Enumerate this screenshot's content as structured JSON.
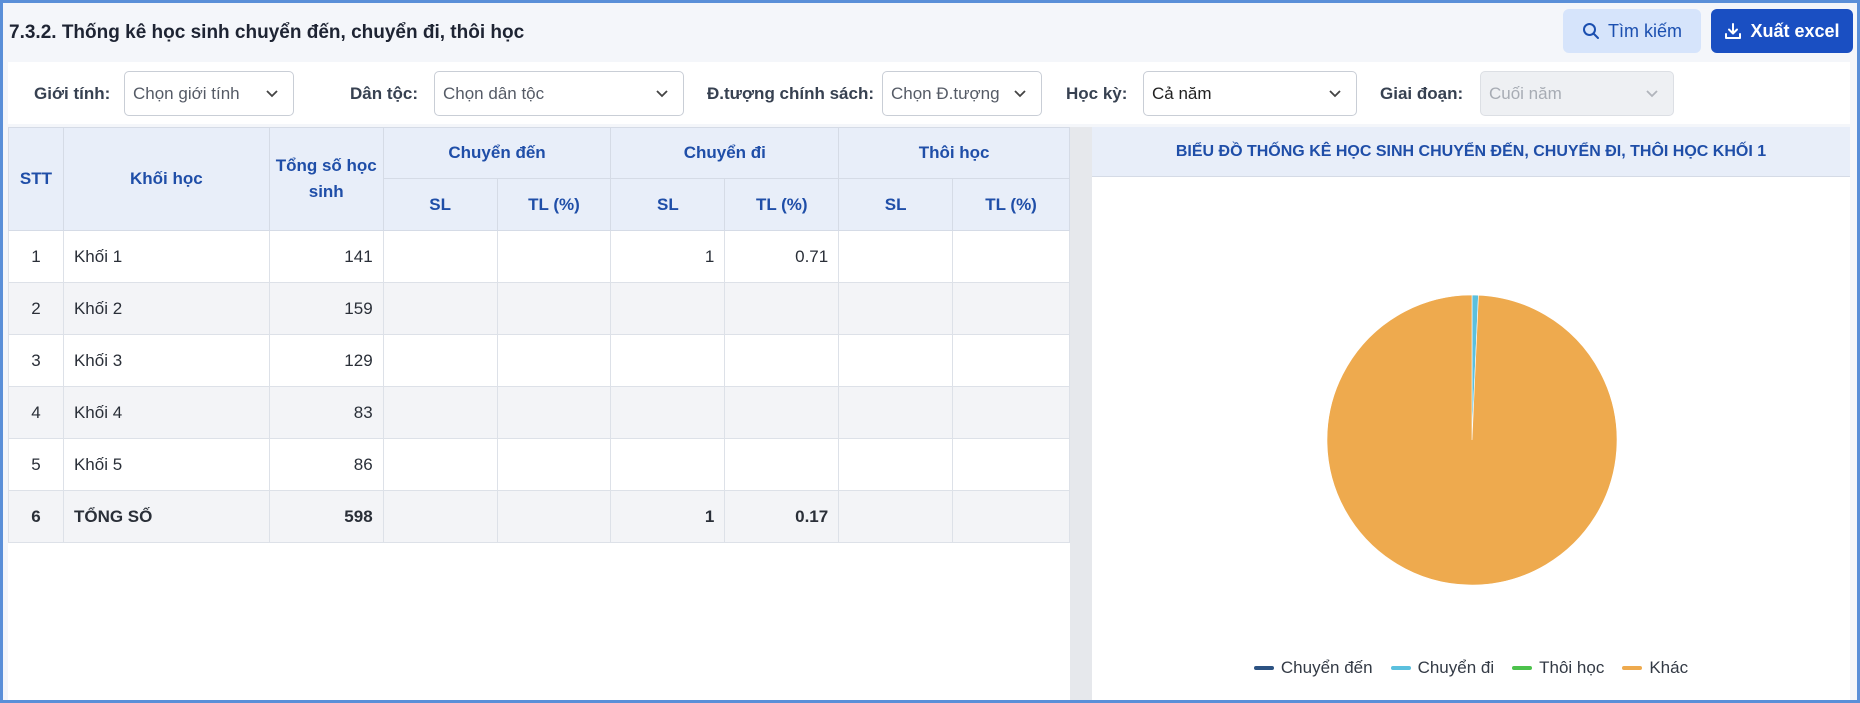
{
  "page": {
    "title": "7.3.2. Thống kê học sinh chuyển đến, chuyển đi, thôi học",
    "search_label": "Tìm kiếm",
    "excel_label": "Xuất excel"
  },
  "filters": {
    "gender": {
      "label": "Giới tính:",
      "value": "Chọn giới tính"
    },
    "ethnicity": {
      "label": "Dân tộc:",
      "value": "Chọn dân tộc"
    },
    "policy": {
      "label": "Đ.tượng chính sách:",
      "value": "Chọn Đ.tượng"
    },
    "semester": {
      "label": "Học kỳ:",
      "value": "Cả năm"
    },
    "stage": {
      "label": "Giai đoạn:",
      "value": "Cuối năm"
    }
  },
  "table": {
    "headers": {
      "stt": "STT",
      "grade": "Khối học",
      "total": "Tổng số học sinh",
      "transfer_in": "Chuyển đến",
      "transfer_out": "Chuyển đi",
      "dropout": "Thôi học",
      "sl": "SL",
      "tl": "TL (%)"
    },
    "rows": [
      {
        "stt": "1",
        "grade": "Khối 1",
        "total": "141",
        "in_sl": "",
        "in_tl": "",
        "out_sl": "1",
        "out_tl": "0.71",
        "drop_sl": "",
        "drop_tl": ""
      },
      {
        "stt": "2",
        "grade": "Khối 2",
        "total": "159",
        "in_sl": "",
        "in_tl": "",
        "out_sl": "",
        "out_tl": "",
        "drop_sl": "",
        "drop_tl": ""
      },
      {
        "stt": "3",
        "grade": "Khối 3",
        "total": "129",
        "in_sl": "",
        "in_tl": "",
        "out_sl": "",
        "out_tl": "",
        "drop_sl": "",
        "drop_tl": ""
      },
      {
        "stt": "4",
        "grade": "Khối 4",
        "total": "83",
        "in_sl": "",
        "in_tl": "",
        "out_sl": "",
        "out_tl": "",
        "drop_sl": "",
        "drop_tl": ""
      },
      {
        "stt": "5",
        "grade": "Khối 5",
        "total": "86",
        "in_sl": "",
        "in_tl": "",
        "out_sl": "",
        "out_tl": "",
        "drop_sl": "",
        "drop_tl": ""
      },
      {
        "stt": "6",
        "grade": "TỔNG SỐ",
        "total": "598",
        "in_sl": "",
        "in_tl": "",
        "out_sl": "1",
        "out_tl": "0.17",
        "drop_sl": "",
        "drop_tl": ""
      }
    ]
  },
  "chart_data": {
    "type": "pie",
    "title": "BIỂU ĐỒ THỐNG KÊ HỌC SINH CHUYỂN ĐẾN, CHUYỂN ĐI, THÔI HỌC KHỐI 1",
    "series": [
      {
        "name": "Chuyển đến",
        "value": 0,
        "color": "#2c5282"
      },
      {
        "name": "Chuyển đi",
        "value": 1,
        "color": "#5bc0de"
      },
      {
        "name": "Thôi học",
        "value": 0,
        "color": "#4cc24c"
      },
      {
        "name": "Khác",
        "value": 140,
        "color": "#eeaa4e"
      }
    ],
    "legend_position": "bottom"
  }
}
